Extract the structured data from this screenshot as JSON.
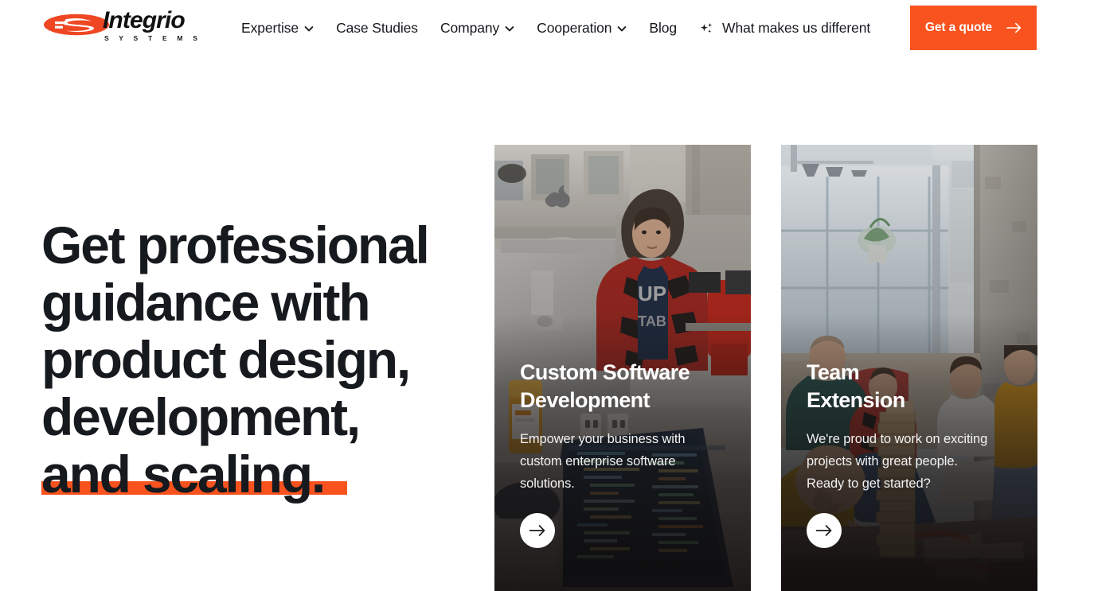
{
  "brand": {
    "name": "Integrio",
    "tagline": "S Y S T E M S",
    "logo_icon": "integrio-is-monogram",
    "accent_color": "#f8521e",
    "text_color": "#16191d"
  },
  "header": {
    "nav": [
      {
        "label": "Expertise",
        "has_dropdown": true,
        "icon": "chevron-down-icon"
      },
      {
        "label": "Case Studies",
        "has_dropdown": false,
        "icon": ""
      },
      {
        "label": "Company",
        "has_dropdown": true,
        "icon": "chevron-down-icon"
      },
      {
        "label": "Cooperation",
        "has_dropdown": true,
        "icon": "chevron-down-icon"
      },
      {
        "label": "Blog",
        "has_dropdown": false,
        "icon": ""
      },
      {
        "label": "What makes us different",
        "has_dropdown": false,
        "icon": "sparkles-icon"
      }
    ],
    "cta": {
      "label": "Get a quote",
      "icon": "arrow-right-icon",
      "background": "#f8521e",
      "text_color": "#ffffff"
    }
  },
  "hero": {
    "headline_lines": [
      "Get professional",
      "guidance with",
      "product design,",
      "development,",
      "and scaling."
    ],
    "highlight_line_index": 4,
    "highlight_color": "#f8521e"
  },
  "cards": [
    {
      "title_lines": [
        "Custom Software",
        "Development"
      ],
      "description_lines": [
        "Empower your business with",
        "custom enterprise software",
        "solutions."
      ],
      "arrow_icon": "arrow-right-icon",
      "image_alt": "developer-at-desk-with-imac-and-laptop"
    },
    {
      "title_lines": [
        "Team",
        "Extension"
      ],
      "description_lines": [
        "We're proud to work on exciting",
        "projects with great people.",
        "Ready to get started?"
      ],
      "arrow_icon": "arrow-right-icon",
      "image_alt": "team-playing-jenga-in-office-lounge"
    }
  ]
}
